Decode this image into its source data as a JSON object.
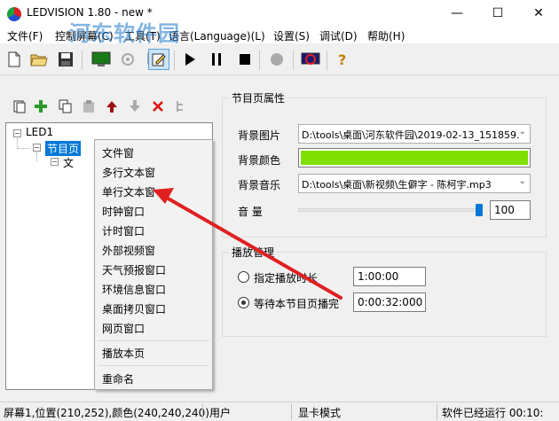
{
  "window": {
    "title": "LEDVISION 1.80 - new *",
    "minimize": "—",
    "maximize": "☐",
    "close": "✕"
  },
  "watermark": {
    "text": "河东软件园",
    "url": "www.pc0359.cn"
  },
  "menu": {
    "file": "文件(F)",
    "control": "控制屏幕(C)",
    "tools": "工具(T)",
    "language": "语言(Language)(L)",
    "settings": "设置(S)",
    "debug": "调试(D)",
    "help": "帮助(H)"
  },
  "tree": {
    "root": "LED1",
    "program": "节目页",
    "child": "文"
  },
  "context_menu": {
    "items": [
      "文件窗",
      "多行文本窗",
      "单行文本窗",
      "时钟窗口",
      "计时窗口",
      "外部视频窗",
      "天气预报窗口",
      "环境信息窗口",
      "桌面拷贝窗口",
      "网页窗口"
    ],
    "play": "播放本页",
    "rename": "重命名"
  },
  "page_props": {
    "group_title": "节目页属性",
    "bg_image_label": "背景图片",
    "bg_image_value": "D:\\tools\\桌面\\河东软件园\\2019-02-13_151859.",
    "bg_color_label": "背景颜色",
    "bg_color": "#7fe000",
    "bg_music_label": "背景音乐",
    "bg_music_value": "D:\\tools\\桌面\\新视频\\生僻字 - 陈柯宇.mp3",
    "volume_label": "音  量",
    "volume_value": "100",
    "volume_level": 1.0
  },
  "playback": {
    "group_title": "播放管理",
    "fixed_duration_label": "指定播放时长",
    "fixed_duration_value": "1:00:00",
    "wait_label": "等待本节目页播完",
    "wait_value": "0:00:32:000",
    "selected": "wait"
  },
  "status": {
    "screen": "屏幕1,位置(210,252),颜色(240,240,240)",
    "user": "用户",
    "mode": "显卡模式",
    "runtime": "软件已经运行 00:10:"
  },
  "colors": {
    "accent": "#0078d7",
    "arrow": "#e02020"
  }
}
